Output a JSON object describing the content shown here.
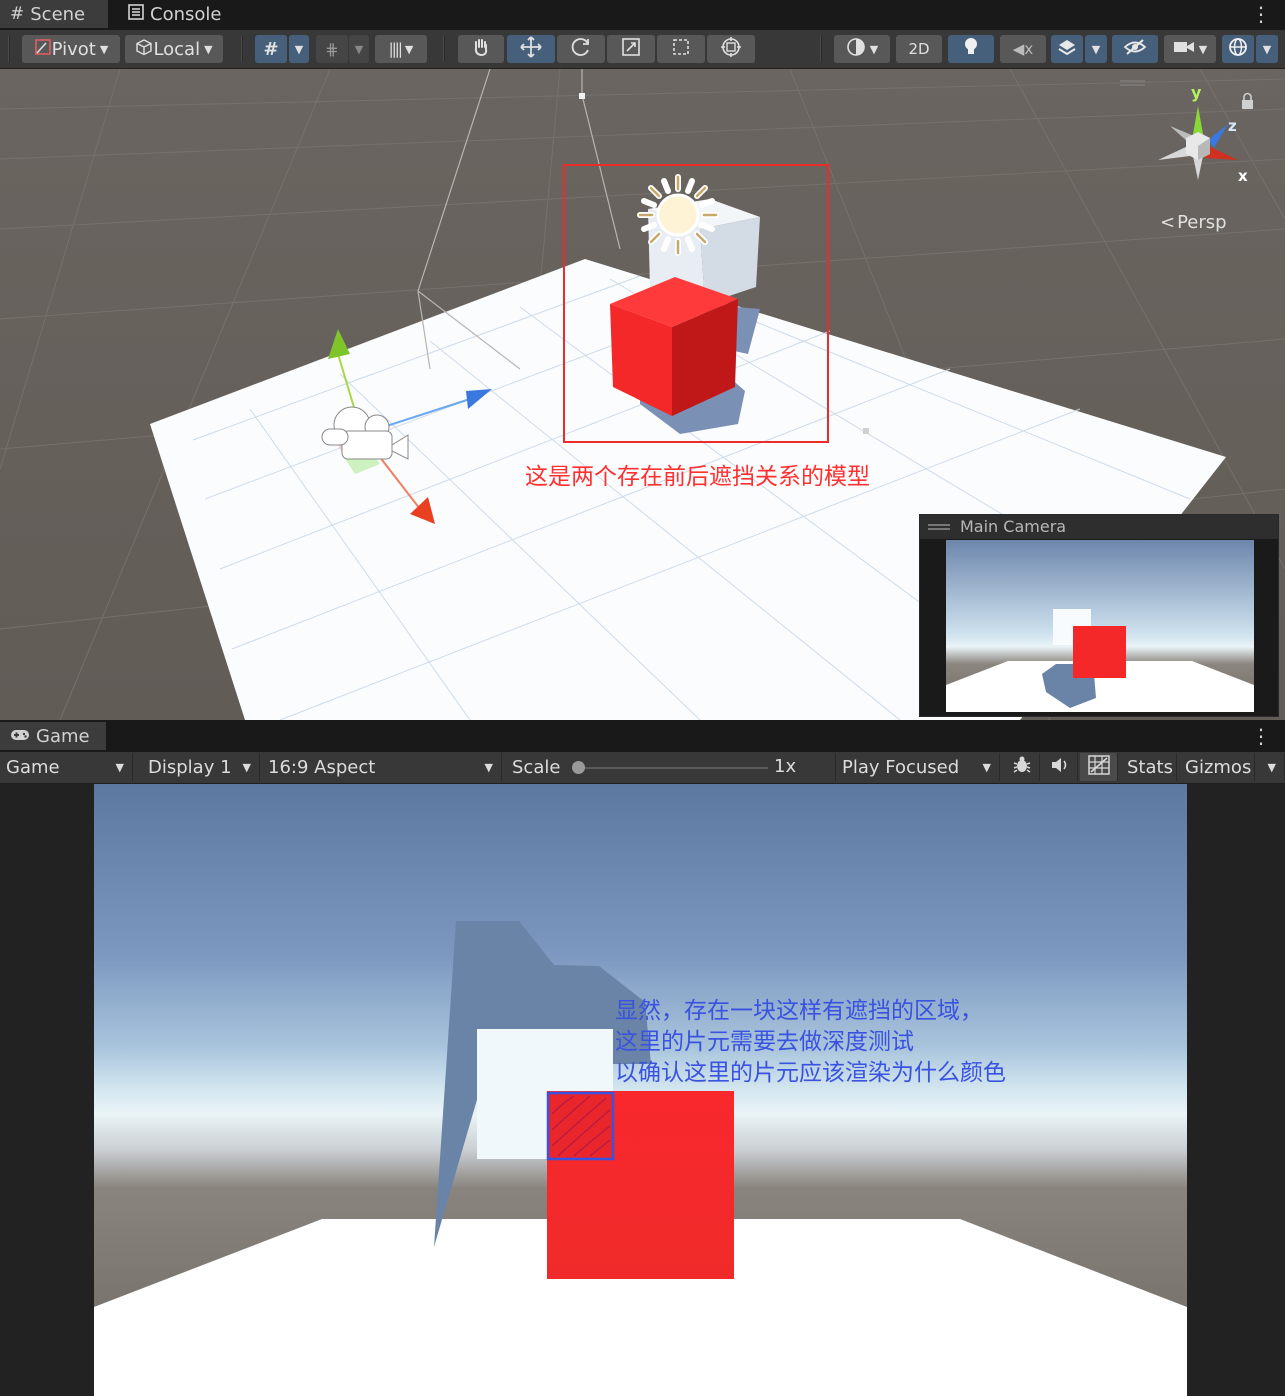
{
  "scene_tabs": {
    "scene_label": "Scene",
    "console_label": "Console",
    "menu_glyph": "⋮"
  },
  "scene_toolbar": {
    "pivot_label": "Pivot",
    "local_label": "Local",
    "mode_2d_label": "2D"
  },
  "scene_view": {
    "gizmo_y": "y",
    "gizmo_z": "z",
    "gizmo_x": "x",
    "persp_label": "Persp",
    "annotation": "这是两个存在前后遮挡关系的模型",
    "annotation_color": "#ff3030",
    "camera_preview_title": "Main Camera"
  },
  "game_tabs": {
    "game_label": "Game",
    "menu_glyph": "⋮"
  },
  "game_toolbar": {
    "game_select": "Game",
    "display_select": "Display 1",
    "aspect_select": "16:9 Aspect",
    "scale_label": "Scale",
    "scale_value": "1x",
    "scale_slider_fraction": 0.0,
    "play_mode_select": "Play Focused",
    "stats_label": "Stats",
    "gizmos_label": "Gizmos"
  },
  "game_view": {
    "annotation_lines": [
      "显然，存在一块这样有遮挡的区域，",
      "这里的片元需要去做深度测试",
      "以确认这里的片元应该渲染为什么颜色"
    ],
    "annotation_color": "#3a52e0",
    "colors": {
      "red_cube": "#f42828",
      "white_cube": "#f0f8fb",
      "shadow": "#6a84a8",
      "floor": "#ffffff",
      "sky_top": "#5c78a0",
      "horizon": "#e8f2f6",
      "ground": "#726c66"
    }
  },
  "icons": {
    "scene_tab": "grid-hash-icon",
    "console_tab": "console-icon",
    "game_tab": "gamepad-icon",
    "hand": "hand-tool-icon",
    "move": "move-tool-icon",
    "rotate": "rotate-tool-icon",
    "scale": "scale-tool-icon",
    "rect": "rect-tool-icon",
    "transform": "transform-tool-icon",
    "light": "lightbulb-icon",
    "audio": "audio-mute-icon",
    "fx": "effects-layers-icon",
    "visibility": "hidden-eye-icon",
    "camera": "camera-icon",
    "gizmos": "gizmo-globe-icon",
    "bug": "bug-icon",
    "speaker": "speaker-icon",
    "grid": "grid-icon"
  }
}
